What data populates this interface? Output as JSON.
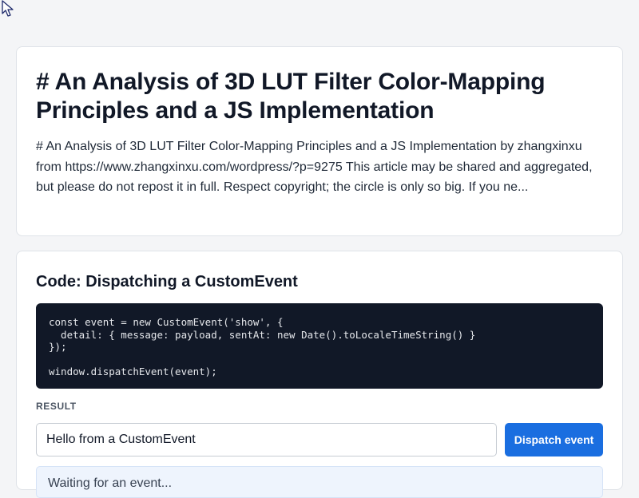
{
  "article": {
    "title": "# An Analysis of 3D LUT Filter Color-Mapping Principles and a JS Implementation",
    "summary": "# An Analysis of 3D LUT Filter Color-Mapping Principles and a JS Implementation by zhangxinxu from https://www.zhangxinxu.com/wordpress/?p=9275 This article may be shared and aggregated, but please do not repost it in full. Respect copyright; the circle is only so big. If you ne..."
  },
  "code_section": {
    "title": "Code: Dispatching a CustomEvent",
    "code": "const event = new CustomEvent('show', {\n  detail: { message: payload, sentAt: new Date().toLocaleTimeString() }\n});\n\nwindow.dispatchEvent(event);",
    "result_label": "RESULT",
    "input_value": "Hello from a CustomEvent",
    "button_label": "Dispatch event",
    "result_text": "Waiting for an event..."
  },
  "icons": {
    "cursor": "mouse-pointer-icon"
  },
  "colors": {
    "accent": "#1a6ee0",
    "code_background": "#111827",
    "result_background": "#eef4fd"
  }
}
